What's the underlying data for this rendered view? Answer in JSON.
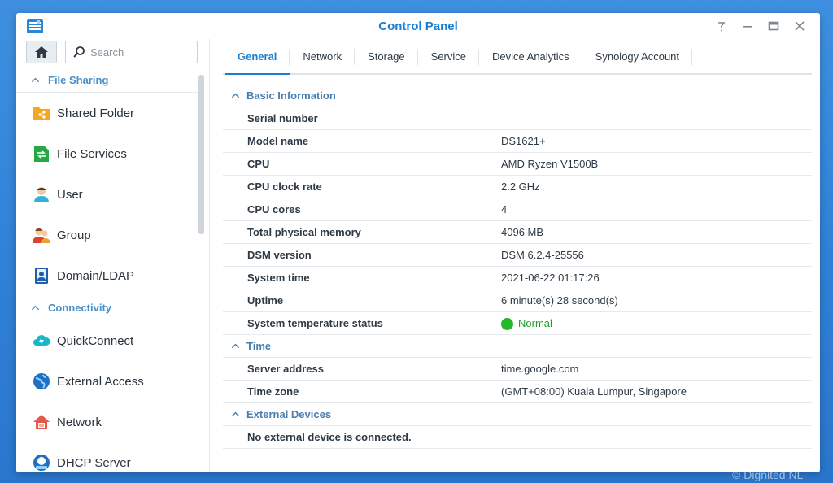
{
  "window": {
    "title": "Control Panel",
    "controls": [
      "help",
      "minimize",
      "maximize",
      "close"
    ]
  },
  "sidebar": {
    "search_placeholder": "Search",
    "sections": [
      {
        "label": "File Sharing",
        "items": [
          {
            "label": "Shared Folder",
            "icon": "shared-folder-icon"
          },
          {
            "label": "File Services",
            "icon": "file-services-icon"
          },
          {
            "label": "User",
            "icon": "user-icon"
          },
          {
            "label": "Group",
            "icon": "group-icon"
          },
          {
            "label": "Domain/LDAP",
            "icon": "domain-ldap-icon"
          }
        ]
      },
      {
        "label": "Connectivity",
        "items": [
          {
            "label": "QuickConnect",
            "icon": "quickconnect-icon"
          },
          {
            "label": "External Access",
            "icon": "external-access-icon"
          },
          {
            "label": "Network",
            "icon": "network-icon"
          },
          {
            "label": "DHCP Server",
            "icon": "dhcp-server-icon"
          }
        ]
      }
    ]
  },
  "tabs": [
    {
      "label": "General",
      "active": true
    },
    {
      "label": "Network",
      "active": false
    },
    {
      "label": "Storage",
      "active": false
    },
    {
      "label": "Service",
      "active": false
    },
    {
      "label": "Device Analytics",
      "active": false
    },
    {
      "label": "Synology Account",
      "active": false
    }
  ],
  "basic_info": {
    "heading": "Basic Information",
    "rows": [
      {
        "label": "Serial number",
        "value": ""
      },
      {
        "label": "Model name",
        "value": "DS1621+"
      },
      {
        "label": "CPU",
        "value": "AMD Ryzen V1500B"
      },
      {
        "label": "CPU clock rate",
        "value": "2.2 GHz"
      },
      {
        "label": "CPU cores",
        "value": "4"
      },
      {
        "label": "Total physical memory",
        "value": "4096 MB"
      },
      {
        "label": "DSM version",
        "value": "DSM 6.2.4-25556"
      },
      {
        "label": "System time",
        "value": "2021-06-22 01:17:26"
      },
      {
        "label": "Uptime",
        "value": "6 minute(s) 28 second(s)"
      }
    ],
    "temperature": {
      "label": "System temperature status",
      "value": "Normal",
      "color": "#22b82a"
    }
  },
  "time": {
    "heading": "Time",
    "rows": [
      {
        "label": "Server address",
        "value": "time.google.com"
      },
      {
        "label": "Time zone",
        "value": "(GMT+08:00) Kuala Lumpur, Singapore"
      }
    ]
  },
  "external_devices": {
    "heading": "External Devices",
    "message": "No external device is connected."
  },
  "watermark": "© Dignited NL",
  "colors": {
    "accent": "#1a7fd0",
    "section": "#4a7fae",
    "status_ok": "#22b82a"
  }
}
